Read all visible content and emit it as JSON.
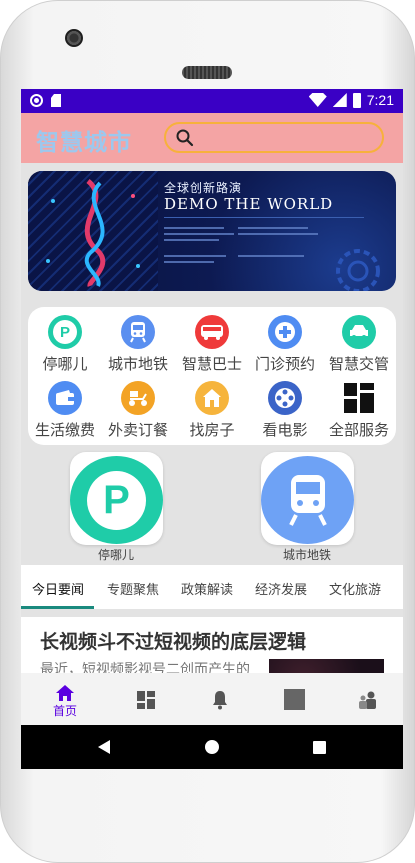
{
  "status_bar": {
    "time": "7:21"
  },
  "app": {
    "title": "智慧城市"
  },
  "search": {
    "placeholder": ""
  },
  "banner": {
    "title_cn": "全球创新路演",
    "title_en": "DEMO THE WORLD"
  },
  "services": [
    {
      "label": "停哪儿",
      "icon": "parking-icon",
      "color": "#1fcca8"
    },
    {
      "label": "城市地铁",
      "icon": "metro-icon",
      "color": "#5a8ff0"
    },
    {
      "label": "智慧巴士",
      "icon": "bus-icon",
      "color": "#ef3a3a"
    },
    {
      "label": "门诊预约",
      "icon": "medical-cross-icon",
      "color": "#4f8cf2"
    },
    {
      "label": "智慧交管",
      "icon": "car-icon",
      "color": "#1fcca8"
    },
    {
      "label": "生活缴费",
      "icon": "wallet-icon",
      "color": "#4f8cf2"
    },
    {
      "label": "外卖订餐",
      "icon": "scooter-icon",
      "color": "#f3a325"
    },
    {
      "label": "找房子",
      "icon": "house-icon",
      "color": "#f6b43c"
    },
    {
      "label": "看电影",
      "icon": "film-reel-icon",
      "color": "#3b64c8"
    },
    {
      "label": "全部服务",
      "icon": "grid-icon",
      "color": "#111111"
    }
  ],
  "tiles": [
    {
      "label": "停哪儿",
      "icon": "parking-icon"
    },
    {
      "label": "城市地铁",
      "icon": "metro-icon"
    }
  ],
  "tabs": [
    "今日要闻",
    "专题聚焦",
    "政策解读",
    "经济发展",
    "文化旅游"
  ],
  "news": {
    "title": "长视频斗不过短视频的底层逻辑",
    "excerpt": "最近，短视频影视号二创而产生的"
  },
  "bottom_nav": [
    {
      "label": "首页",
      "icon": "home-icon"
    },
    {
      "label": "",
      "icon": "dashboard-icon"
    },
    {
      "label": "",
      "icon": "bell-icon"
    },
    {
      "label": "",
      "icon": "square-icon"
    },
    {
      "label": "",
      "icon": "people-icon"
    }
  ],
  "colors": {
    "status_bar": "#3a00c5",
    "app_bar": "#f4a4a4",
    "accent": "#5a00e0",
    "tab_indicator": "#1a8a7e"
  }
}
